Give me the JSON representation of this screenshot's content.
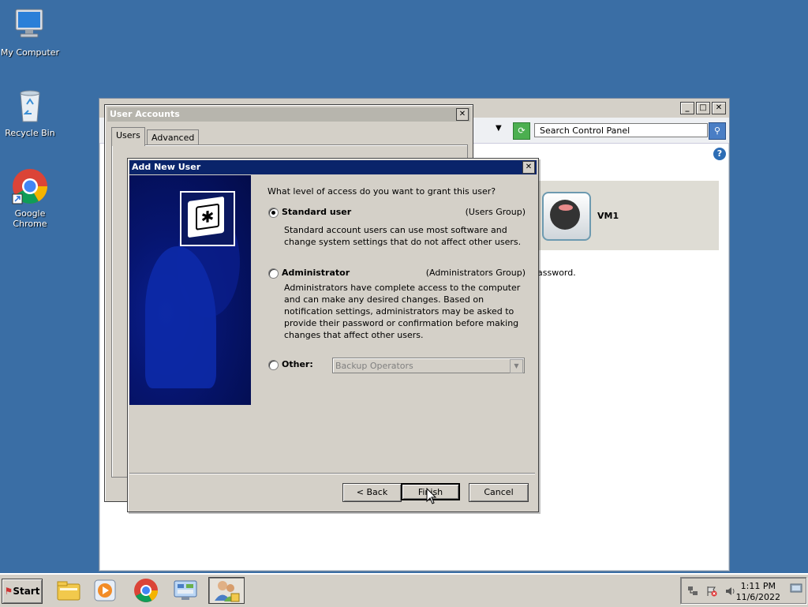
{
  "desktop": {
    "icons": [
      {
        "label": "My Computer"
      },
      {
        "label": "Recycle Bin"
      },
      {
        "label": "Google Chrome"
      }
    ]
  },
  "control_panel": {
    "search_placeholder": "Search Control Panel",
    "user_name": "VM1",
    "partial_text": "assword."
  },
  "user_accounts": {
    "title": "User Accounts",
    "tabs": [
      "Users",
      "Advanced"
    ]
  },
  "add_new_user": {
    "title": "Add New User",
    "question": "What level of access do you want to grant this user?",
    "options": [
      {
        "label": "Standard user",
        "group": "(Users Group)",
        "desc": "Standard account users can use most software and change system settings that do not affect other users.",
        "checked": true
      },
      {
        "label": "Administrator",
        "group": "(Administrators Group)",
        "desc": "Administrators have complete access to the computer and can make any desired changes. Based on notification settings, administrators may be asked to provide their password or confirmation before making changes that affect other users.",
        "checked": false
      },
      {
        "label": "Other:",
        "select_value": "Backup Operators",
        "checked": false
      }
    ],
    "buttons": {
      "back": "< Back",
      "finish": "Finish",
      "cancel": "Cancel"
    }
  },
  "taskbar": {
    "start_label": "Start",
    "clock_time": "1:11 PM",
    "clock_date": "11/6/2022"
  },
  "colors": {
    "desktop": "#3a6ea5",
    "active_title": "#0a246a",
    "inactive_title": "#b7b5ad",
    "face": "#d4d0c8"
  }
}
